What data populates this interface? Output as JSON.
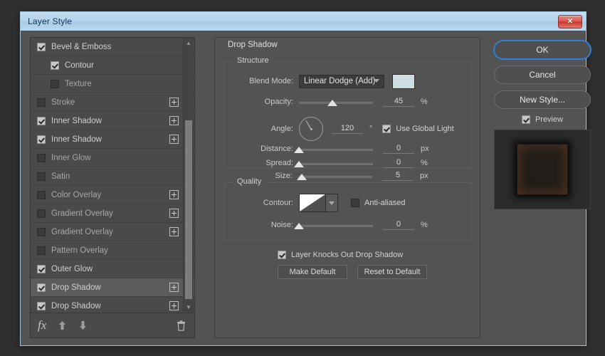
{
  "window": {
    "title": "Layer Style",
    "close_label": "✕"
  },
  "effects": {
    "items": [
      {
        "label": "Bevel & Emboss",
        "checked": true,
        "sub": false,
        "plus": false,
        "selected": false
      },
      {
        "label": "Contour",
        "checked": true,
        "sub": true,
        "plus": false,
        "selected": false
      },
      {
        "label": "Texture",
        "checked": false,
        "sub": true,
        "plus": false,
        "selected": false
      },
      {
        "label": "Stroke",
        "checked": false,
        "sub": false,
        "plus": true,
        "selected": false
      },
      {
        "label": "Inner Shadow",
        "checked": true,
        "sub": false,
        "plus": true,
        "selected": false
      },
      {
        "label": "Inner Shadow",
        "checked": true,
        "sub": false,
        "plus": true,
        "selected": false
      },
      {
        "label": "Inner Glow",
        "checked": false,
        "sub": false,
        "plus": false,
        "selected": false
      },
      {
        "label": "Satin",
        "checked": false,
        "sub": false,
        "plus": false,
        "selected": false
      },
      {
        "label": "Color Overlay",
        "checked": false,
        "sub": false,
        "plus": true,
        "selected": false
      },
      {
        "label": "Gradient Overlay",
        "checked": false,
        "sub": false,
        "plus": true,
        "selected": false
      },
      {
        "label": "Gradient Overlay",
        "checked": false,
        "sub": false,
        "plus": true,
        "selected": false
      },
      {
        "label": "Pattern Overlay",
        "checked": false,
        "sub": false,
        "plus": false,
        "selected": false
      },
      {
        "label": "Outer Glow",
        "checked": true,
        "sub": false,
        "plus": false,
        "selected": false
      },
      {
        "label": "Drop Shadow",
        "checked": true,
        "sub": false,
        "plus": true,
        "selected": true
      },
      {
        "label": "Drop Shadow",
        "checked": true,
        "sub": false,
        "plus": true,
        "selected": false
      }
    ],
    "toolbar": {
      "fx_label": "fx",
      "up_label": "▲",
      "down_label": "▼",
      "trash_label": "🗑"
    }
  },
  "settings": {
    "panel_title": "Drop Shadow",
    "structure": {
      "group_label": "Structure",
      "blend_mode_label": "Blend Mode:",
      "blend_mode_value": "Linear Dodge (Add)",
      "color_swatch": "#ccdee0",
      "opacity_label": "Opacity:",
      "opacity_value": "45",
      "opacity_unit": "%",
      "opacity_percent": 45,
      "angle_label": "Angle:",
      "angle_value": "120",
      "angle_unit": "°",
      "angle_degrees": 120,
      "global_light_label": "Use Global Light",
      "global_light_checked": true,
      "distance_label": "Distance:",
      "distance_value": "0",
      "distance_unit": "px",
      "distance_percent": 0,
      "spread_label": "Spread:",
      "spread_value": "0",
      "spread_unit": "%",
      "spread_percent": 0,
      "size_label": "Size:",
      "size_value": "5",
      "size_unit": "px",
      "size_percent": 5
    },
    "quality": {
      "group_label": "Quality",
      "contour_label": "Contour:",
      "anti_aliased_label": "Anti-aliased",
      "anti_aliased_checked": false,
      "noise_label": "Noise:",
      "noise_value": "0",
      "noise_unit": "%",
      "noise_percent": 0
    },
    "footer": {
      "knockout_label": "Layer Knocks Out Drop Shadow",
      "knockout_checked": true,
      "make_default_label": "Make Default",
      "reset_default_label": "Reset to Default"
    }
  },
  "actions": {
    "ok_label": "OK",
    "cancel_label": "Cancel",
    "new_style_label": "New Style...",
    "preview_label": "Preview",
    "preview_checked": true
  }
}
